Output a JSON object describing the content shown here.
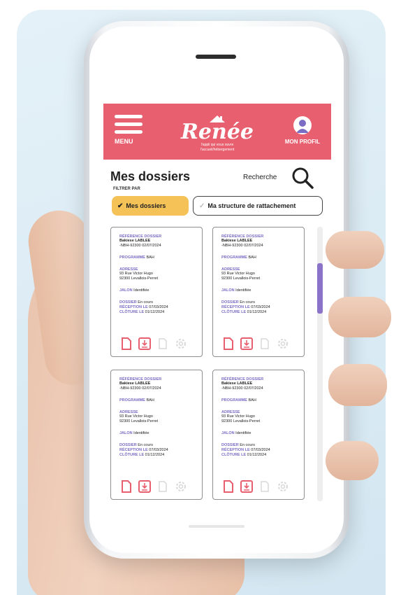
{
  "header": {
    "menu_label": "MENU",
    "logo_title": "Renée",
    "logo_tagline_1": "l'appli qui vous ouvre",
    "logo_tagline_2": "l'accueil/hébergement",
    "profile_label": "MON PROFIL"
  },
  "page": {
    "title": "Mes dossiers",
    "search_label": "Recherche",
    "filter_label": "FILTRER PAR"
  },
  "filters": {
    "chip_1": "Mes dossiers",
    "chip_2": "Ma structure de rattachement"
  },
  "cards": [
    {
      "ref_label": "RÉFÉRENCE DOSSIER",
      "name": "Bakiese LABLEE",
      "ref": "-NBH-92300 02/07/2024",
      "program_key": "PROGRAMME",
      "program_val": "BAH",
      "address_key": "ADRESSE",
      "address_1": "93 Rue Victor Hugo",
      "address_2": "92300 Levallois-Perret",
      "status_key": "JALON",
      "status_val": "Identifiée",
      "line_1_key": "DOSSIER",
      "line_1_val": "En cours",
      "line_2_key": "RÉCEPTION LE",
      "line_2_val": "07/03/2024",
      "line_3_key": "CLÔTURE LE",
      "line_3_val": "01/12/2024"
    },
    {
      "ref_label": "RÉFÉRENCE DOSSIER",
      "name": "Bakiese LABLEE",
      "ref": "-NBH-92300 02/07/2024",
      "program_key": "PROGRAMME",
      "program_val": "BAH",
      "address_key": "ADRESSE",
      "address_1": "93 Rue Victor Hugo",
      "address_2": "92300 Levallois-Perret",
      "status_key": "JALON",
      "status_val": "Identifiée",
      "line_1_key": "DOSSIER",
      "line_1_val": "En cours",
      "line_2_key": "RÉCEPTION LE",
      "line_2_val": "07/03/2024",
      "line_3_key": "CLÔTURE LE",
      "line_3_val": "01/12/2024"
    },
    {
      "ref_label": "RÉFÉRENCE DOSSIER",
      "name": "Bakiese LABLEE",
      "ref": "-NBH-92300 02/07/2024",
      "program_key": "PROGRAMME",
      "program_val": "BAH",
      "address_key": "ADRESSE",
      "address_1": "93 Rue Victor Hugo",
      "address_2": "92300 Levallois-Perret",
      "status_key": "JALON",
      "status_val": "Identifiée",
      "line_1_key": "DOSSIER",
      "line_1_val": "En cours",
      "line_2_key": "RÉCEPTION LE",
      "line_2_val": "07/03/2024",
      "line_3_key": "CLÔTURE LE",
      "line_3_val": "01/12/2024"
    },
    {
      "ref_label": "RÉFÉRENCE DOSSIER",
      "name": "Bakiese LABLEE",
      "ref": "-NBH-92300 02/07/2024",
      "program_key": "PROGRAMME",
      "program_val": "BAH",
      "address_key": "ADRESSE",
      "address_1": "93 Rue Victor Hugo",
      "address_2": "92300 Levallois-Perret",
      "status_key": "JALON",
      "status_val": "Identifiée",
      "line_1_key": "DOSSIER",
      "line_1_val": "En cours",
      "line_2_key": "RÉCEPTION LE",
      "line_2_val": "07/03/2024",
      "line_3_key": "CLÔTURE LE",
      "line_3_val": "01/12/2024"
    }
  ],
  "icons": [
    "document-icon",
    "download-icon",
    "file-icon",
    "settings-icon"
  ],
  "colors": {
    "header": "#e8606f",
    "chip_active": "#f5c258",
    "accent": "#7b6cc4",
    "icon_active": "#e8606f",
    "icon_disabled": "#d8d8d8",
    "background": "#dcebf4"
  }
}
